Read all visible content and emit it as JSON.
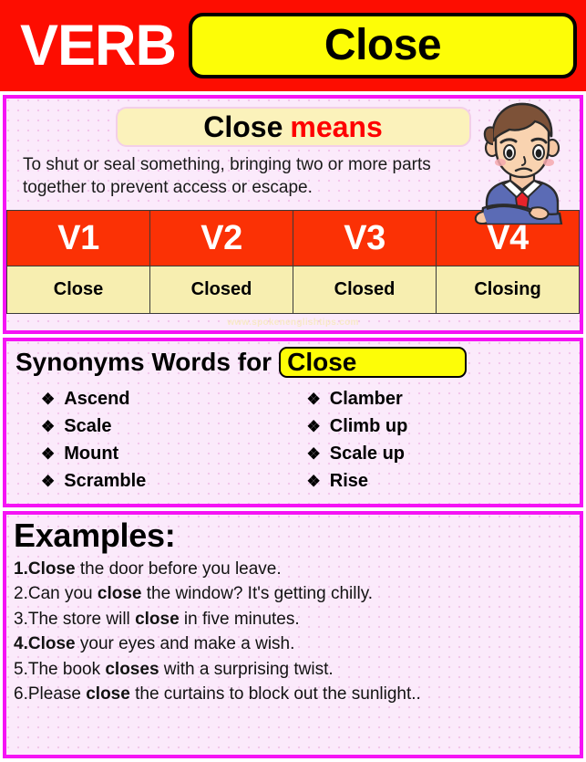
{
  "header": {
    "category_label": "VERB",
    "word": "Close"
  },
  "meaning": {
    "chip_word": "Close",
    "chip_label": "means",
    "definition": "To shut or seal something, bringing two or more parts together to prevent access or escape.",
    "illustration": "thinking-man-illustration"
  },
  "verb_forms": {
    "headers": [
      "V1",
      "V2",
      "V3",
      "V4"
    ],
    "values": [
      "Close",
      "Closed",
      "Closed",
      "Closing"
    ],
    "watermark": "www.spokenenglishtips.com"
  },
  "synonyms": {
    "title": "Synonyms Words for",
    "chip_word": "Close",
    "bullet_glyph": "❖",
    "left_column": [
      "Ascend",
      "Scale",
      "Mount",
      "Scramble"
    ],
    "right_column": [
      "Clamber",
      "Climb up",
      "Scale up",
      "Rise"
    ]
  },
  "examples": {
    "title": "Examples:",
    "items": [
      {
        "number": "1.",
        "number_bold": true,
        "before": "",
        "bold": "Close",
        "after": " the door before you leave."
      },
      {
        "number": "2.",
        "number_bold": false,
        "before": "Can you ",
        "bold": "close",
        "after": " the window? It's getting chilly."
      },
      {
        "number": "3.",
        "number_bold": false,
        "before": "The store will ",
        "bold": "close",
        "after": " in five minutes."
      },
      {
        "number": "4.",
        "number_bold": true,
        "before": "",
        "bold": "Close",
        "after": " your eyes and make a wish."
      },
      {
        "number": "5.",
        "number_bold": false,
        "before": "The book ",
        "bold": "closes",
        "after": " with a surprising twist."
      },
      {
        "number": "6.",
        "number_bold": false,
        "before": "Please ",
        "bold": "close",
        "after": " the curtains to block out the sunlight.."
      }
    ]
  },
  "colors": {
    "header_red": "#fd0d01",
    "chip_yellow": "#fdfd07",
    "section_border_magenta": "#f513f5",
    "table_header_orange": "#fb3105",
    "table_cell_cream": "#f7eeb0",
    "accent_red_text": "#fe0000",
    "page_pink": "#fbeafb"
  }
}
